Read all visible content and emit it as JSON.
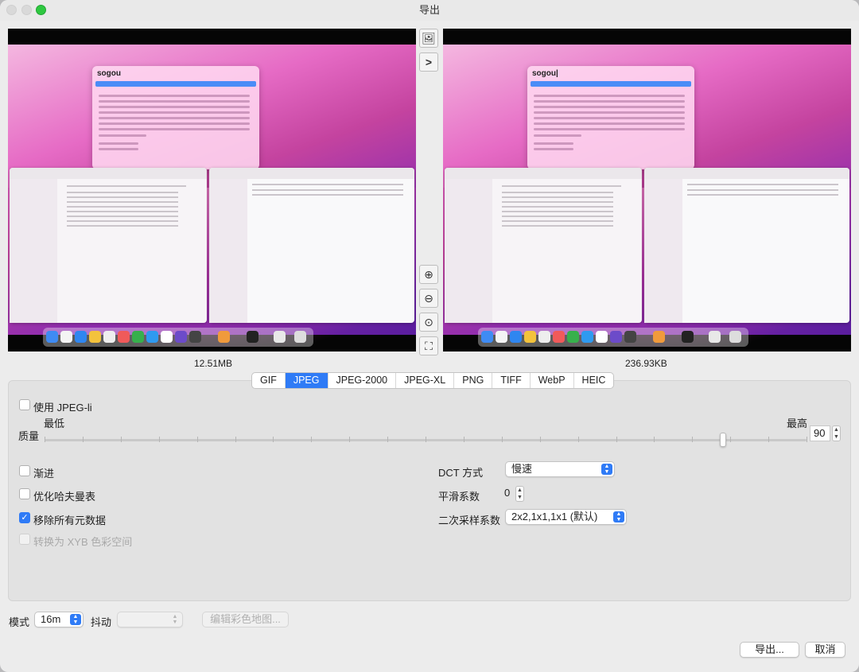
{
  "window": {
    "title": "导出"
  },
  "preview": {
    "left_size": "12.51MB",
    "right_size": "236.93KB",
    "search_query": "sogou",
    "search_query_right": "sogou|"
  },
  "format_tabs": [
    "GIF",
    "JPEG",
    "JPEG-2000",
    "JPEG-XL",
    "PNG",
    "TIFF",
    "WebP",
    "HEIC"
  ],
  "active_tab": "JPEG",
  "jpeg": {
    "use_jpegli_label": "使用 JPEG-li",
    "quality_label": "质量",
    "min_label": "最低",
    "max_label": "最高",
    "quality_value": "90",
    "quality_fraction": 0.89,
    "progressive_label": "渐进",
    "optimize_huffman_label": "优化哈夫曼表",
    "strip_metadata_label": "移除所有元数据",
    "xyb_label": "转换为 XYB 色彩空间",
    "dct_label": "DCT 方式",
    "dct_value": "慢速",
    "smoothing_label": "平滑系数",
    "smoothing_value": "0",
    "subsampling_label": "二次采样系数",
    "subsampling_value": "2x2,1x1,1x1 (默认)"
  },
  "bottom": {
    "mode_label": "模式",
    "mode_value": "16m",
    "dither_label": "抖动",
    "dither_value": "",
    "edit_colormap_label": "编辑彩色地图...",
    "export_label": "导出...",
    "cancel_label": "取消"
  },
  "state": {
    "use_jpegli": false,
    "progressive": false,
    "optimize_huffman": false,
    "strip_metadata": true,
    "xyb": false
  }
}
